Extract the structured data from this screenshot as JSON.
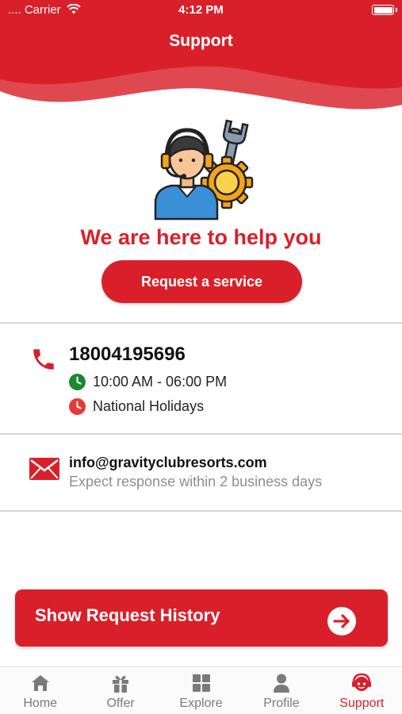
{
  "status_bar": {
    "carrier": "Carrier",
    "time": "4:12 PM"
  },
  "header": {
    "title": "Support"
  },
  "hero": {
    "tagline": "We are here to help you",
    "request_button": "Request a service",
    "illustration_icon": "support-agent-gear-icon"
  },
  "phone_contact": {
    "number": "18004195696",
    "hours": "10:00 AM - 06:00 PM",
    "holidays": "National Holidays",
    "hours_color": "#1a8a2e",
    "holiday_color": "#e53935"
  },
  "email_contact": {
    "address": "info@gravityclubresorts.com",
    "note": "Expect response within 2 business days"
  },
  "history_button": {
    "label": "Show Request History"
  },
  "tab_bar": {
    "items": [
      {
        "label": "Home",
        "icon": "home-icon",
        "active": false
      },
      {
        "label": "Offer",
        "icon": "gift-icon",
        "active": false
      },
      {
        "label": "Explore",
        "icon": "grid-icon",
        "active": false
      },
      {
        "label": "Profile",
        "icon": "person-icon",
        "active": false
      },
      {
        "label": "Support",
        "icon": "support-face-icon",
        "active": true
      }
    ]
  },
  "colors": {
    "brand": "#d9202a",
    "muted_text": "#8e8e8e",
    "inactive_tab": "#7a7a7a"
  }
}
